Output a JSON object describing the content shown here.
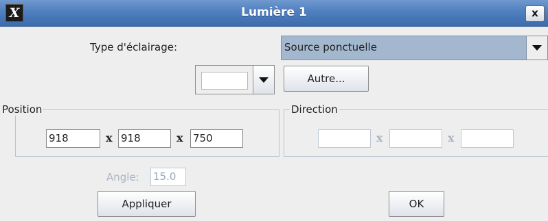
{
  "window": {
    "title": "Lumière 1",
    "icon": "x-logo-icon",
    "icon_glyph": "X",
    "close_glyph": "x"
  },
  "lighting": {
    "type_label": "Type d'éclairage:",
    "type_value": "Source ponctuelle"
  },
  "color": {
    "swatch_color": "#ffffff",
    "other_button": "Autre..."
  },
  "position": {
    "title": "Position",
    "x": "918",
    "y": "918",
    "z": "750",
    "separator": "x"
  },
  "direction": {
    "title": "Direction",
    "x": "",
    "y": "",
    "z": "",
    "separator": "x"
  },
  "angle": {
    "label": "Angle:",
    "value": "15.0"
  },
  "buttons": {
    "apply": "Appliquer",
    "ok": "OK"
  }
}
